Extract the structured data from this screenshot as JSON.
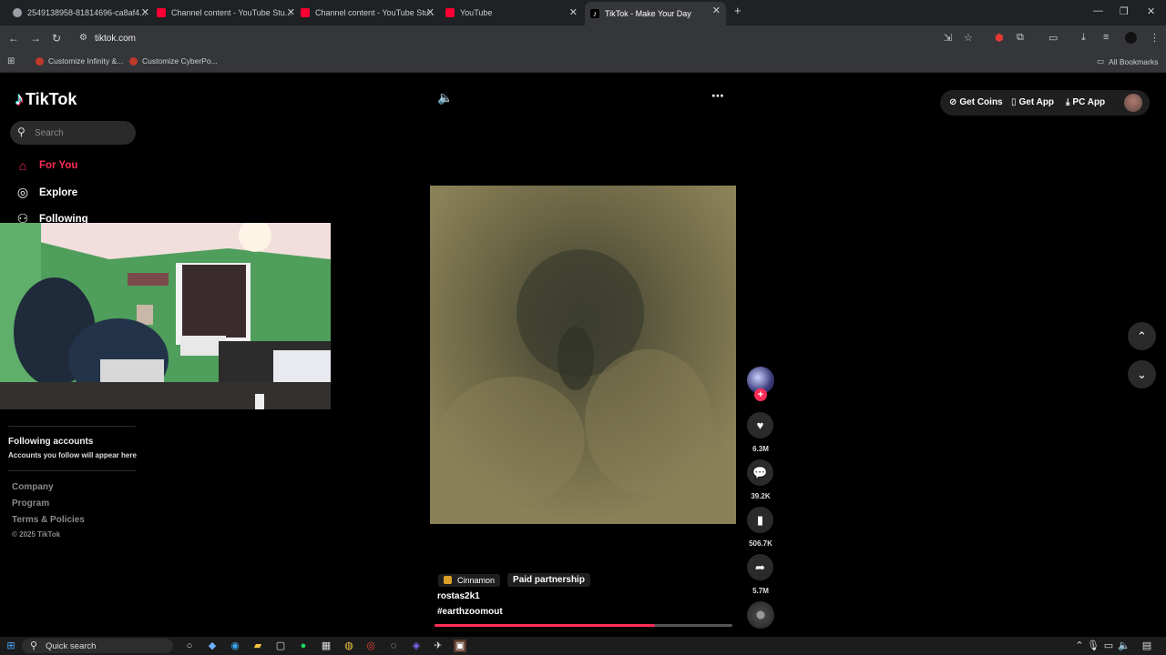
{
  "browser": {
    "tabs": [
      {
        "title": "2549138958-81814696-ca8af4...",
        "color": "#9aa0a6"
      },
      {
        "title": "Channel content - YouTube Stu...",
        "color": "#ff0033"
      },
      {
        "title": "Channel content - YouTube Stu...",
        "color": "#ff0033"
      },
      {
        "title": "YouTube",
        "color": "#ff0033"
      },
      {
        "title": "TikTok - Make Your Day",
        "color": "#ffffff"
      }
    ],
    "url": "tiktok.com",
    "bookmarks": [
      "Customize Infinity &...",
      "Customize CyberPo..."
    ],
    "all_bookmarks": "All Bookmarks"
  },
  "sidebar": {
    "logo": "TikTok",
    "search_placeholder": "Search",
    "nav": [
      {
        "label": "For You",
        "icon": "home-icon"
      },
      {
        "label": "Explore",
        "icon": "compass-icon"
      },
      {
        "label": "Following",
        "icon": "user-follow-icon"
      }
    ],
    "following_title": "Following accounts",
    "following_sub": "Accounts you follow will appear here",
    "footer_links": [
      "Company",
      "Program",
      "Terms & Policies"
    ],
    "copyright": "© 2025 TikTok"
  },
  "header": {
    "get_coins": "Get Coins",
    "get_app": "Get App",
    "pc_app": "PC App"
  },
  "video": {
    "likes": "6.3M",
    "comments": "39.2K",
    "saves": "506.7K",
    "shares": "5.7M",
    "chip_label": "Cinnamon",
    "paid_label": "Paid partnership",
    "handle": "rostas2k1",
    "hashtag": "#earthzoomout",
    "progress": 0.74
  },
  "taskbar": {
    "search": "Quick search"
  },
  "colors": {
    "accent": "#fe2c55",
    "page_bg": "#000000"
  }
}
